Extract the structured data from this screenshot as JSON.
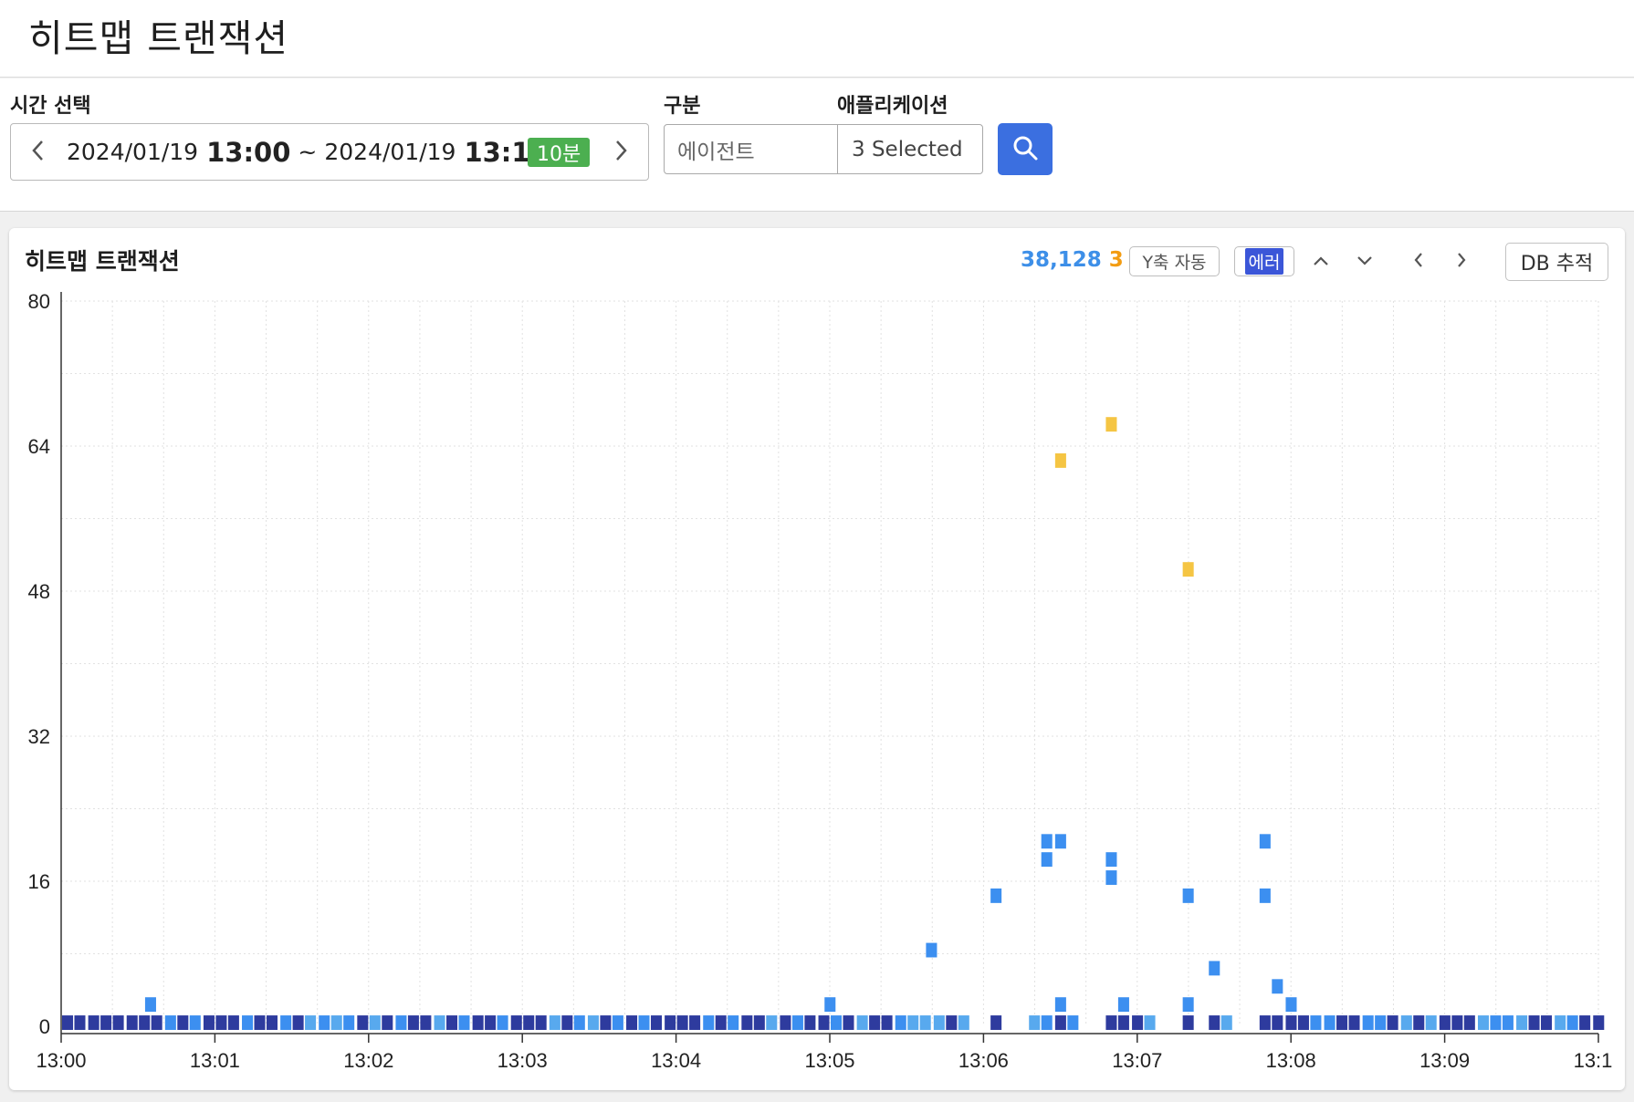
{
  "page": {
    "title": "히트맵 트랜잭션"
  },
  "filters": {
    "time_label": "시간 선택",
    "start_date": "2024/01/19",
    "start_hm": "13:00",
    "separator": "~",
    "end_date": "2024/01/19",
    "end_hm": "13:10",
    "duration_badge": "10분",
    "category_label": "구분",
    "category_value": "에이전트",
    "application_label": "애플리케이션",
    "application_value": "3 Selected"
  },
  "panel": {
    "title": "히트맵 트랜잭션",
    "count_total": "38,128",
    "count_error": "3",
    "y_axis_auto_label": "Y축 자동",
    "error_toggle_label": "에러",
    "db_trace_label": "DB 추적"
  },
  "colors": {
    "accent_blue": "#3b6fe0",
    "badge_green": "#4caf50",
    "count_blue": "#3d8fe8",
    "count_orange": "#f39c12",
    "cell_dark": "#2e3b9e",
    "cell_mid": "#3c8ff0",
    "cell_light": "#58a9ee",
    "cell_error": "#f5c543"
  },
  "icons": [
    "chevron-left-icon",
    "chevron-right-icon",
    "search-icon",
    "chevron-up-icon",
    "chevron-down-icon"
  ],
  "chart_data": {
    "type": "heatmap",
    "x_tick_labels": [
      "13:00",
      "13:01",
      "13:02",
      "13:03",
      "13:04",
      "13:05",
      "13:06",
      "13:07",
      "13:08",
      "13:09",
      "13:1"
    ],
    "y_tick_labels": [
      "0",
      "16",
      "32",
      "48",
      "64",
      "80"
    ],
    "xlim_minutes": [
      0,
      10
    ],
    "ylim": [
      0,
      80
    ],
    "grid": true,
    "baseline_row": {
      "y": 0.4,
      "cells": [
        [
          0.0,
          "dark"
        ],
        [
          0.08,
          "dark"
        ],
        [
          0.17,
          "dark"
        ],
        [
          0.25,
          "dark"
        ],
        [
          0.33,
          "dark"
        ],
        [
          0.42,
          "dark"
        ],
        [
          0.5,
          "dark"
        ],
        [
          0.58,
          "dark"
        ],
        [
          0.67,
          "mid"
        ],
        [
          0.75,
          "dark"
        ],
        [
          0.83,
          "mid"
        ],
        [
          0.92,
          "dark"
        ],
        [
          1.0,
          "dark"
        ],
        [
          1.08,
          "dark"
        ],
        [
          1.17,
          "mid"
        ],
        [
          1.25,
          "dark"
        ],
        [
          1.33,
          "dark"
        ],
        [
          1.42,
          "mid"
        ],
        [
          1.5,
          "dark"
        ],
        [
          1.58,
          "light"
        ],
        [
          1.67,
          "mid"
        ],
        [
          1.75,
          "light"
        ],
        [
          1.83,
          "mid"
        ],
        [
          1.92,
          "dark"
        ],
        [
          2.0,
          "light"
        ],
        [
          2.08,
          "dark"
        ],
        [
          2.17,
          "mid"
        ],
        [
          2.25,
          "dark"
        ],
        [
          2.33,
          "dark"
        ],
        [
          2.42,
          "light"
        ],
        [
          2.5,
          "dark"
        ],
        [
          2.58,
          "mid"
        ],
        [
          2.67,
          "dark"
        ],
        [
          2.75,
          "dark"
        ],
        [
          2.83,
          "mid"
        ],
        [
          2.92,
          "dark"
        ],
        [
          3.0,
          "dark"
        ],
        [
          3.08,
          "dark"
        ],
        [
          3.17,
          "light"
        ],
        [
          3.25,
          "dark"
        ],
        [
          3.33,
          "mid"
        ],
        [
          3.42,
          "light"
        ],
        [
          3.5,
          "dark"
        ],
        [
          3.58,
          "mid"
        ],
        [
          3.67,
          "dark"
        ],
        [
          3.75,
          "mid"
        ],
        [
          3.83,
          "dark"
        ],
        [
          3.92,
          "dark"
        ],
        [
          4.0,
          "dark"
        ],
        [
          4.08,
          "dark"
        ],
        [
          4.17,
          "mid"
        ],
        [
          4.25,
          "dark"
        ],
        [
          4.33,
          "mid"
        ],
        [
          4.42,
          "dark"
        ],
        [
          4.5,
          "dark"
        ],
        [
          4.58,
          "light"
        ],
        [
          4.67,
          "dark"
        ],
        [
          4.75,
          "mid"
        ],
        [
          4.83,
          "dark"
        ],
        [
          4.92,
          "dark"
        ],
        [
          5.0,
          "mid"
        ],
        [
          5.08,
          "dark"
        ],
        [
          5.17,
          "light"
        ],
        [
          5.25,
          "dark"
        ],
        [
          5.33,
          "dark"
        ],
        [
          5.42,
          "mid"
        ],
        [
          5.5,
          "light"
        ],
        [
          5.58,
          "light"
        ],
        [
          5.67,
          "light"
        ],
        [
          5.75,
          "dark"
        ],
        [
          5.83,
          "light"
        ],
        [
          6.04,
          "dark"
        ],
        [
          6.29,
          "light"
        ],
        [
          6.37,
          "mid"
        ],
        [
          6.46,
          "dark"
        ],
        [
          6.54,
          "mid"
        ],
        [
          6.79,
          "dark"
        ],
        [
          6.87,
          "dark"
        ],
        [
          6.96,
          "dark"
        ],
        [
          7.04,
          "light"
        ],
        [
          7.29,
          "dark"
        ],
        [
          7.46,
          "dark"
        ],
        [
          7.54,
          "light"
        ],
        [
          7.79,
          "dark"
        ],
        [
          7.87,
          "dark"
        ],
        [
          7.96,
          "dark"
        ],
        [
          8.04,
          "dark"
        ],
        [
          8.12,
          "mid"
        ],
        [
          8.21,
          "mid"
        ],
        [
          8.29,
          "dark"
        ],
        [
          8.37,
          "dark"
        ],
        [
          8.46,
          "mid"
        ],
        [
          8.54,
          "mid"
        ],
        [
          8.62,
          "dark"
        ],
        [
          8.71,
          "light"
        ],
        [
          8.79,
          "dark"
        ],
        [
          8.87,
          "light"
        ],
        [
          8.96,
          "dark"
        ],
        [
          9.04,
          "dark"
        ],
        [
          9.12,
          "dark"
        ],
        [
          9.21,
          "light"
        ],
        [
          9.29,
          "mid"
        ],
        [
          9.37,
          "mid"
        ],
        [
          9.46,
          "light"
        ],
        [
          9.54,
          "dark"
        ],
        [
          9.62,
          "dark"
        ],
        [
          9.71,
          "light"
        ],
        [
          9.79,
          "mid"
        ],
        [
          9.87,
          "dark"
        ],
        [
          9.96,
          "dark"
        ]
      ]
    },
    "points": [
      {
        "x": 0.54,
        "y": 2.4,
        "kind": "mid"
      },
      {
        "x": 4.96,
        "y": 2.4,
        "kind": "mid"
      },
      {
        "x": 5.62,
        "y": 8.4,
        "kind": "mid"
      },
      {
        "x": 6.04,
        "y": 14.4,
        "kind": "mid"
      },
      {
        "x": 6.37,
        "y": 20.4,
        "kind": "mid"
      },
      {
        "x": 6.46,
        "y": 20.4,
        "kind": "mid"
      },
      {
        "x": 6.37,
        "y": 18.4,
        "kind": "mid"
      },
      {
        "x": 6.46,
        "y": 2.4,
        "kind": "mid"
      },
      {
        "x": 6.79,
        "y": 18.4,
        "kind": "mid"
      },
      {
        "x": 6.79,
        "y": 16.4,
        "kind": "mid"
      },
      {
        "x": 6.87,
        "y": 2.4,
        "kind": "mid"
      },
      {
        "x": 7.29,
        "y": 14.4,
        "kind": "mid"
      },
      {
        "x": 7.29,
        "y": 2.4,
        "kind": "mid"
      },
      {
        "x": 7.46,
        "y": 6.4,
        "kind": "mid"
      },
      {
        "x": 7.79,
        "y": 20.4,
        "kind": "mid"
      },
      {
        "x": 7.79,
        "y": 14.4,
        "kind": "mid"
      },
      {
        "x": 7.87,
        "y": 4.4,
        "kind": "mid"
      },
      {
        "x": 7.96,
        "y": 2.4,
        "kind": "mid"
      },
      {
        "x": 6.46,
        "y": 62.4,
        "kind": "error"
      },
      {
        "x": 6.79,
        "y": 66.4,
        "kind": "error"
      },
      {
        "x": 7.29,
        "y": 50.4,
        "kind": "error"
      }
    ]
  }
}
